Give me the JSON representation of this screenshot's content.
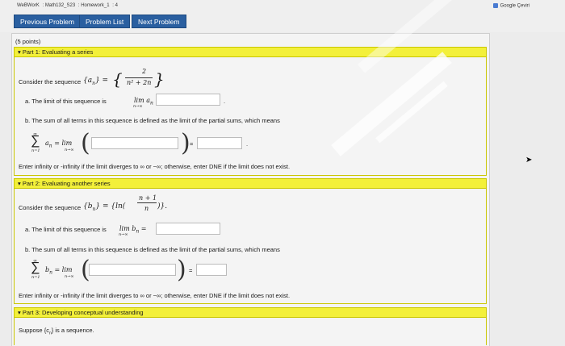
{
  "breadcrumb": [
    "WeBWorK",
    "Math132_S23",
    "Homework_1",
    "4"
  ],
  "nav": {
    "previous": "Previous Problem",
    "list": "Problem List",
    "next": "Next Problem"
  },
  "google_label": "Google Çeviri",
  "points": "(5 points)",
  "part1": {
    "header": "Part 1: Evaluating a series",
    "consider": "Consider the sequence",
    "seq_lhs": "{a",
    "seq_sub": "n",
    "seq_rhs": "} =",
    "seq_num": "2",
    "seq_den": "n² + 2n",
    "a_text": "a. The limit of this sequence is",
    "a_lim": "lim a",
    "a_sub": "n→∞",
    "a_eq": "=",
    "b_text": "b. The sum of all terms in this sequence is defined as the limit of the partial sums, which means",
    "sum_top": "∞",
    "sum_bot": "n=1",
    "sum_term": "a",
    "sum_eq": "= lim",
    "sum_lim_sub": "n→∞",
    "eq": "=",
    "note": "Enter infinity or -infinity if the limit diverges to ∞ or −∞; otherwise, enter DNE if the limit does not exist."
  },
  "part2": {
    "header": "Part 2: Evaluating another series",
    "consider": "Consider the sequence",
    "seq_lhs": "{b",
    "seq_sub": "n",
    "seq_rhs": "} = {ln(",
    "seq_num": "n + 1",
    "seq_den": "n",
    "seq_close": ")}.",
    "a_text": "a. The limit of this sequence is",
    "a_lim": "lim b",
    "a_sub": "n→∞",
    "a_eq": "=",
    "b_text": "b. The sum of all terms in this sequence is defined as the limit of the partial sums, which means",
    "sum_top": "∞",
    "sum_bot": "n=1",
    "sum_term": "b",
    "sum_eq": "= lim",
    "sum_lim_sub": "n→∞",
    "eq": "=",
    "note": "Enter infinity or -infinity if the limit diverges to ∞ or −∞; otherwise, enter DNE if the limit does not exist."
  },
  "part3": {
    "header": "Part 3: Developing conceptual understanding",
    "suppose": "Suppose {c",
    "suppose_sub": "n",
    "suppose_end": "} is a sequence."
  }
}
